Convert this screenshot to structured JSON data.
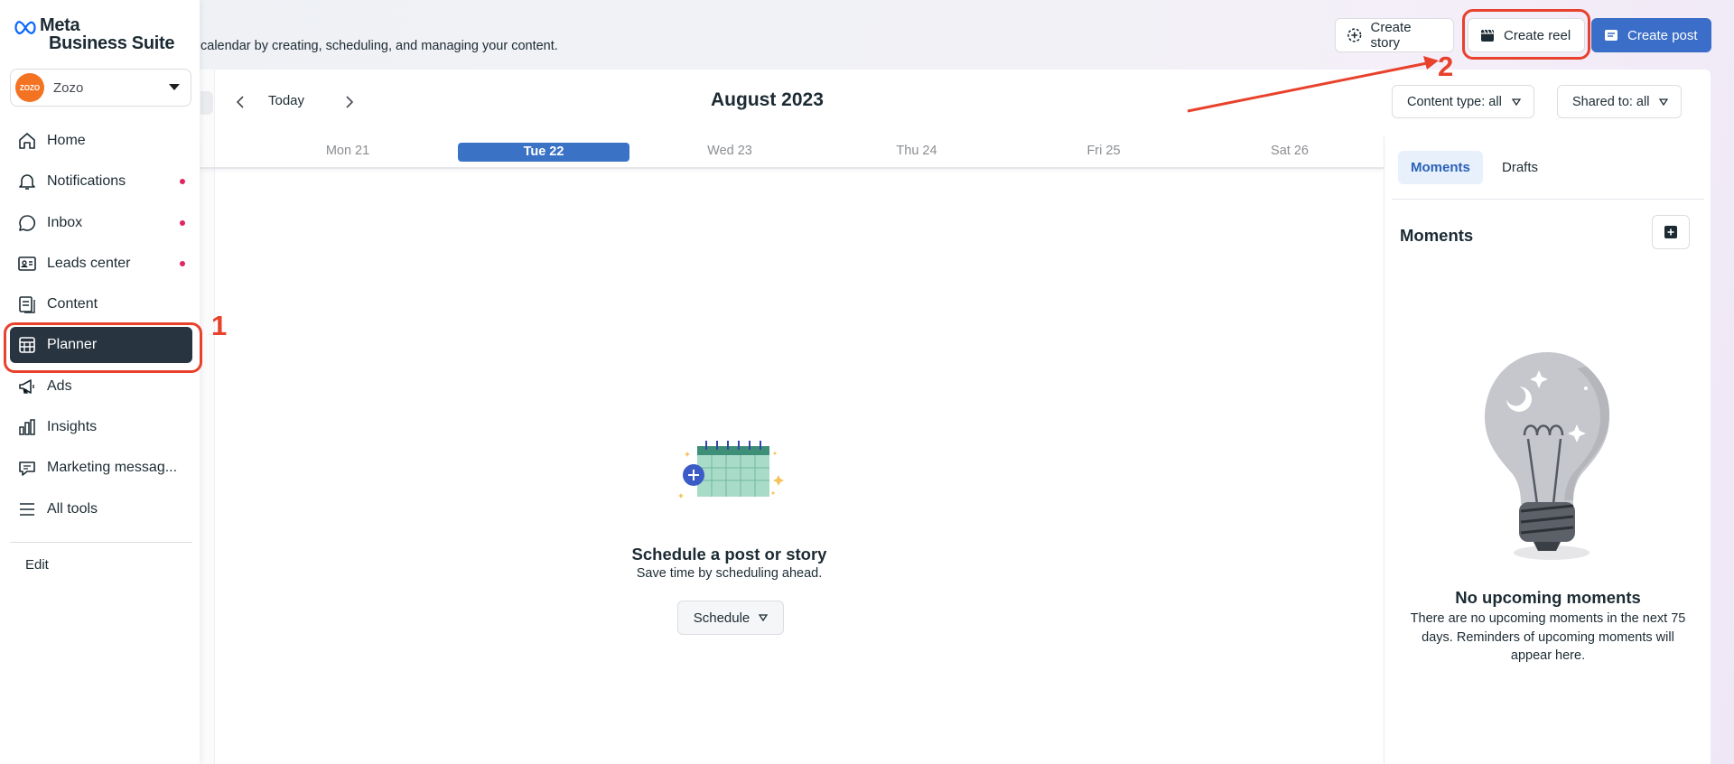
{
  "sidebar": {
    "logo_line1": "Meta",
    "logo_line2": "Business Suite",
    "account": {
      "name": "Zozo",
      "avatar_text": "ZOZO"
    },
    "items": [
      {
        "label": "Home",
        "icon": "home-icon",
        "dot": false
      },
      {
        "label": "Notifications",
        "icon": "bell-icon",
        "dot": true
      },
      {
        "label": "Inbox",
        "icon": "chat-bubble-icon",
        "dot": true
      },
      {
        "label": "Leads center",
        "icon": "contact-card-icon",
        "dot": true
      },
      {
        "label": "Content",
        "icon": "content-pages-icon",
        "dot": false
      },
      {
        "label": "Planner",
        "icon": "calendar-grid-icon",
        "dot": false,
        "active": true
      },
      {
        "label": "Ads",
        "icon": "megaphone-icon",
        "dot": false
      },
      {
        "label": "Insights",
        "icon": "bar-chart-icon",
        "dot": false
      },
      {
        "label": "Marketing messag...",
        "icon": "message-bubble-icon",
        "dot": false
      },
      {
        "label": "All tools",
        "icon": "hamburger-icon",
        "dot": false
      }
    ],
    "edit_label": "Edit"
  },
  "header": {
    "subtitle": "calendar by creating, scheduling, and managing your content.",
    "create_story": "Create story",
    "create_reel": "Create reel",
    "create_post": "Create post"
  },
  "toolbar": {
    "today": "Today",
    "month": "August 2023",
    "content_type": "Content type: all",
    "shared_to": "Shared to: all"
  },
  "days": [
    {
      "label": "Mon 21",
      "active": false
    },
    {
      "label": "Tue 22",
      "active": true
    },
    {
      "label": "Wed 23",
      "active": false
    },
    {
      "label": "Thu 24",
      "active": false
    },
    {
      "label": "Fri 25",
      "active": false
    },
    {
      "label": "Sat 26",
      "active": false
    }
  ],
  "empty_state": {
    "title": "Schedule a post or story",
    "subtitle": "Save time by scheduling ahead.",
    "button": "Schedule"
  },
  "right_panel": {
    "tabs": [
      "Moments",
      "Drafts"
    ],
    "title": "Moments",
    "empty_title": "No upcoming moments",
    "empty_desc": "There are no upcoming moments in the next 75 days. Reminders of upcoming moments will appear here."
  },
  "annotations": {
    "num1": "1",
    "num2": "2"
  },
  "colors": {
    "primary": "#3b6ec9",
    "annotation": "#e8412c",
    "active_nav": "#283541",
    "avatar": "#f47322"
  }
}
